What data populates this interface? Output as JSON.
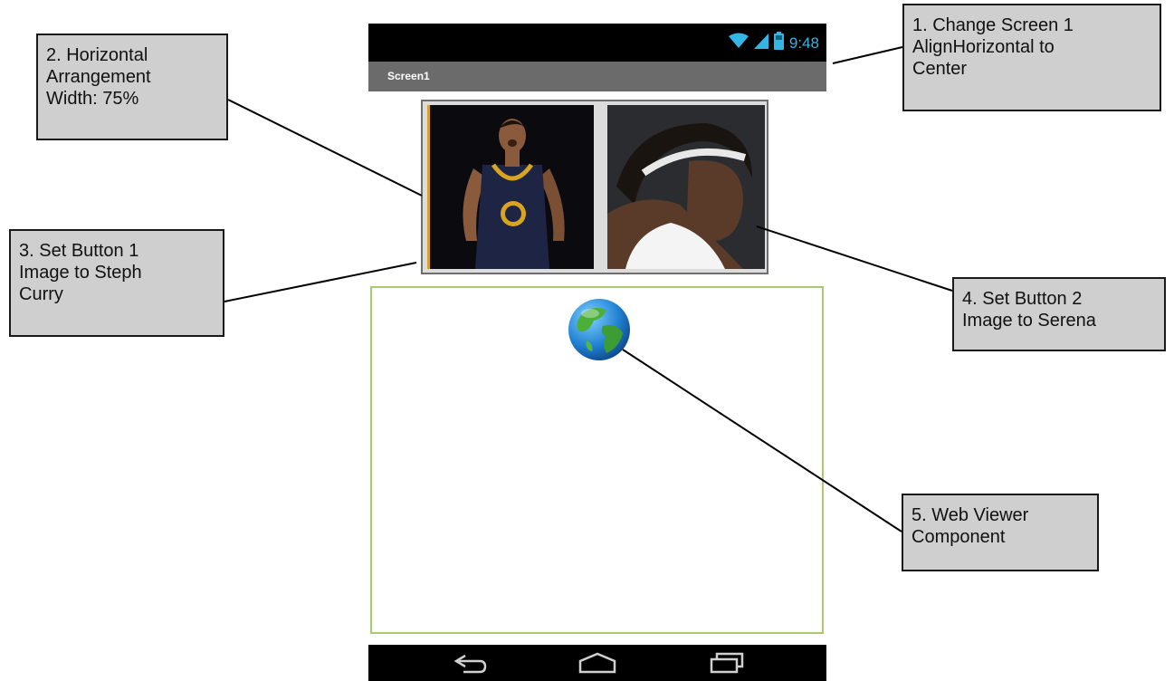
{
  "phone": {
    "status_time": "9:48",
    "screen_title": "Screen1"
  },
  "annotations": {
    "note1": "1. Change Screen 1\nAlignHorizontal to\nCenter",
    "note2": "2. Horizontal\nArrangement\nWidth: 75%",
    "note3": "3. Set Button 1\nImage to Steph\nCurry",
    "note4": "4. Set Button 2\nImage to Serena",
    "note5": "5. Web Viewer\nComponent"
  },
  "icons": {
    "wifi": "wifi-icon",
    "signal": "signal-icon",
    "battery": "battery-icon",
    "back": "back-icon",
    "home": "home-icon",
    "recents": "recents-icon",
    "globe": "globe-icon"
  },
  "colors": {
    "status_accent": "#33b5e5",
    "title_bar": "#6b6b6b",
    "webviewer_border": "#a8cc6a",
    "note_fill": "#cfcfcf"
  }
}
